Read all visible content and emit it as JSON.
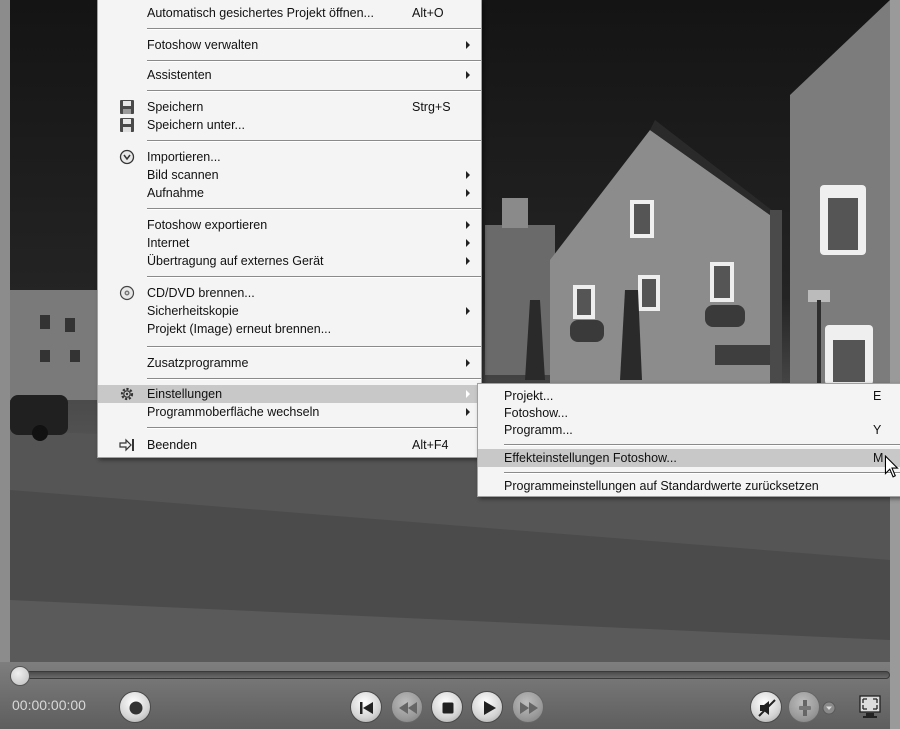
{
  "main_menu": {
    "items": [
      {
        "label": "Automatisch gesichertes Projekt öffnen...",
        "shortcut": "Alt+O"
      },
      {
        "label": "Fotoshow verwalten"
      },
      {
        "label": "Assistenten"
      },
      {
        "label": "Speichern",
        "shortcut": "Strg+S",
        "icon": "save-icon"
      },
      {
        "label": "Speichern unter...",
        "icon": "save-as-icon"
      },
      {
        "label": "Importieren...",
        "icon": "import-icon"
      },
      {
        "label": "Bild scannen"
      },
      {
        "label": "Aufnahme"
      },
      {
        "label": "Fotoshow exportieren"
      },
      {
        "label": "Internet"
      },
      {
        "label": "Übertragung auf externes Gerät"
      },
      {
        "label": "CD/DVD brennen...",
        "icon": "disc-icon"
      },
      {
        "label": "Sicherheitskopie"
      },
      {
        "label": "Projekt (Image) erneut brennen..."
      },
      {
        "label": "Zusatzprogramme"
      },
      {
        "label": "Einstellungen",
        "icon": "gear-icon",
        "highlighted": true
      },
      {
        "label": "Programmoberfläche wechseln"
      },
      {
        "label": "Beenden",
        "shortcut": "Alt+F4",
        "icon": "exit-icon"
      }
    ]
  },
  "submenu": {
    "items": [
      {
        "label": "Projekt...",
        "shortcut": "E"
      },
      {
        "label": "Fotoshow..."
      },
      {
        "label": "Programm...",
        "shortcut": "Y"
      },
      {
        "label": "Effekteinstellungen Fotoshow...",
        "shortcut": "M",
        "highlighted": true
      },
      {
        "label": "Programmeinstellungen auf Standardwerte zurücksetzen"
      }
    ]
  },
  "player": {
    "timecode": "00:00:00:00",
    "position": 0
  },
  "colors": {
    "menu_bg": "#f4f4f4",
    "highlight": "#c8c8c8",
    "player_bg": "#6e6e6e"
  }
}
